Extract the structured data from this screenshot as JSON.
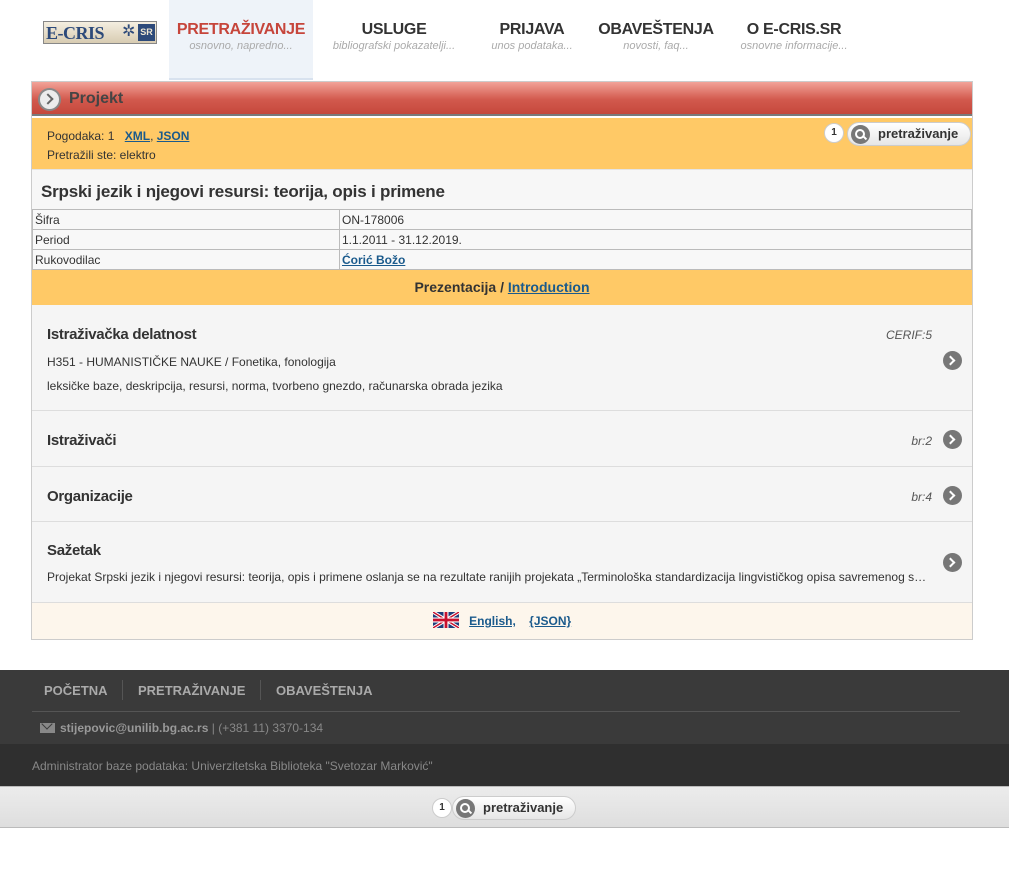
{
  "logo": {
    "text": "E-CRIS",
    "badge": "SR"
  },
  "nav": [
    {
      "label": "PRETRAŽIVANJE",
      "sub": "osnovno, napredno..."
    },
    {
      "label": "USLUGE",
      "sub": "bibliografski pokazatelji..."
    },
    {
      "label": "PRIJAVA",
      "sub": "unos podataka..."
    },
    {
      "label": "OBAVEŠTENJA",
      "sub": "novosti, faq..."
    },
    {
      "label": "O E-CRIS.SR",
      "sub": "osnovne informacije..."
    }
  ],
  "panel": {
    "title": "Projekt",
    "hits_label": "Pogodaka: 1",
    "xml_link": "XML",
    "json_link": "JSON",
    "query": "Pretražili ste: elektro",
    "page_num": "1",
    "search_button": "pretraživanje"
  },
  "project": {
    "title": "Srpski jezik i njegovi resursi: teorija, opis i primene",
    "fields": [
      {
        "key": "Šifra",
        "value": "ON-178006"
      },
      {
        "key": "Period",
        "value": "1.1.2011 - 31.12.2019."
      },
      {
        "key": "Rukovodilac",
        "value": "Ćorić Božo"
      }
    ]
  },
  "presentation": {
    "label": "Prezentacija /",
    "link": "Introduction"
  },
  "sections": {
    "research": {
      "title": "Istraživačka delatnost",
      "meta": "CERIF:5",
      "line1": "H351 - HUMANISTIČKE NAUKE / Fonetika, fonologija",
      "line2": "leksičke baze, deskripcija, resursi, norma, tvorbeno gnezdo, računarska obrada jezika"
    },
    "researchers": {
      "title": "Istraživači",
      "meta": "br:2"
    },
    "organizations": {
      "title": "Organizacije",
      "meta": "br:4"
    },
    "abstract": {
      "title": "Sažetak",
      "text": "Projekat Srpski jezik i njegovi resursi: teorija, opis i primene oslanja se na rezultate ranijih projekata „Terminološka standardizacija lingvističkog opisa savremenog srpskog jezika"
    }
  },
  "panel_footer": {
    "english": "English,",
    "json": "{JSON}"
  },
  "footer": {
    "nav": [
      "POČETNA",
      "PRETRAŽIVANJE",
      "OBAVEŠTENJA"
    ],
    "email": "stijepovic@unilib.bg.ac.rs",
    "phone": "| (+381 11) 3370-134",
    "admin": "Administrator baze podataka: Univerzitetska Biblioteka \"Svetozar Marković\""
  },
  "bottom_bar": {
    "page_num": "1",
    "search_button": "pretraživanje"
  }
}
